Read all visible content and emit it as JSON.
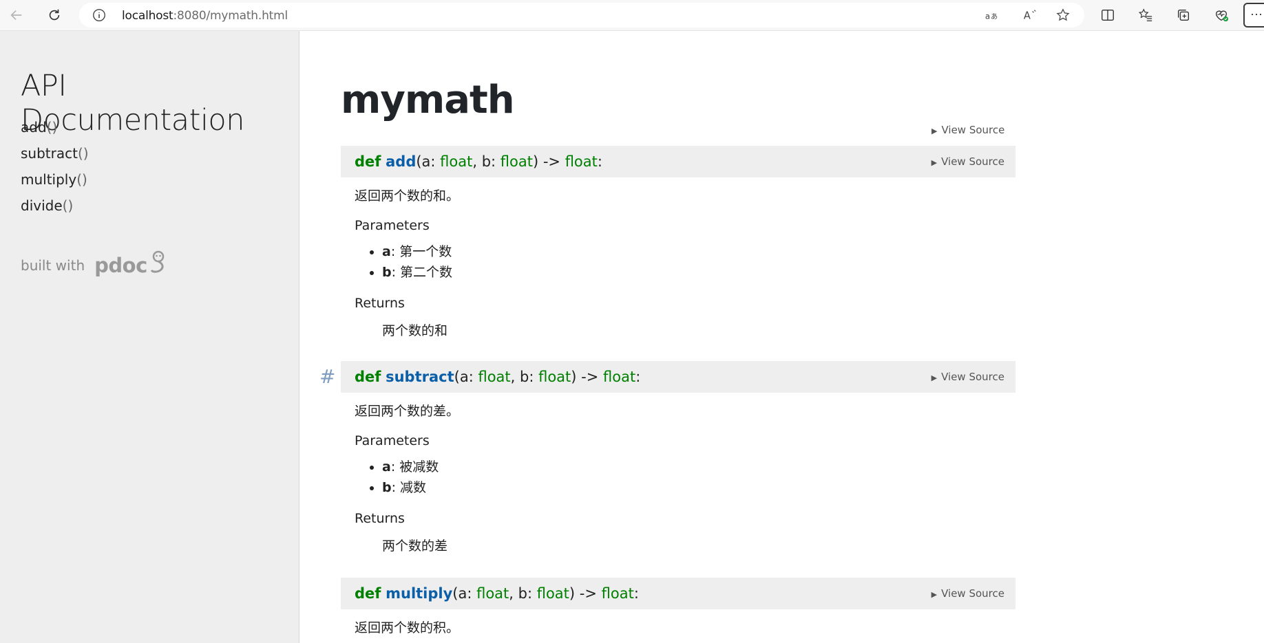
{
  "browser": {
    "url_host": "localhost",
    "url_rest": ":8080/mymath.html",
    "more_label": "···"
  },
  "sidebar": {
    "title": "API Documentation",
    "items": [
      {
        "name": "add",
        "paren": "()"
      },
      {
        "name": "subtract",
        "paren": "()"
      },
      {
        "name": "multiply",
        "paren": "()"
      },
      {
        "name": "divide",
        "paren": "()"
      }
    ],
    "built_with": "built with",
    "pdoc": "pdoc"
  },
  "module": {
    "title": "mymath",
    "view_source": "View Source"
  },
  "functions": [
    {
      "def": "def",
      "name": "add",
      "open": "(a: ",
      "t1": "float",
      "mid": ", b: ",
      "t2": "float",
      "arrow": ") -> ",
      "t3": "float",
      "colon": ":",
      "view_source": "View Source",
      "summary": "返回两个数的和。",
      "params_label": "Parameters",
      "params": [
        {
          "name": "a",
          "desc": ": 第一个数"
        },
        {
          "name": "b",
          "desc": ": 第二个数"
        }
      ],
      "returns_label": "Returns",
      "returns": "两个数的和"
    },
    {
      "anchor": "#",
      "def": "def",
      "name": "subtract",
      "open": "(a: ",
      "t1": "float",
      "mid": ", b: ",
      "t2": "float",
      "arrow": ") -> ",
      "t3": "float",
      "colon": ":",
      "view_source": "View Source",
      "summary": "返回两个数的差。",
      "params_label": "Parameters",
      "params": [
        {
          "name": "a",
          "desc": ": 被减数"
        },
        {
          "name": "b",
          "desc": ": 减数"
        }
      ],
      "returns_label": "Returns",
      "returns": "两个数的差"
    },
    {
      "def": "def",
      "name": "multiply",
      "open": "(a: ",
      "t1": "float",
      "mid": ", b: ",
      "t2": "float",
      "arrow": ") -> ",
      "t3": "float",
      "colon": ":",
      "view_source": "View Source",
      "summary": "返回两个数的积。"
    }
  ],
  "colors": {
    "keyword": "#008000",
    "function_name": "#0b5ea8",
    "signature_bg": "#eeeeee",
    "sidebar_bg": "#eeeeee"
  },
  "icons": [
    "back-arrow-icon",
    "refresh-icon",
    "info-icon",
    "translate-icon",
    "read-aloud-icon",
    "star-icon",
    "split-screen-icon",
    "favorites-icon",
    "collections-icon",
    "browser-essentials-icon",
    "pdoc-snake-icon"
  ]
}
